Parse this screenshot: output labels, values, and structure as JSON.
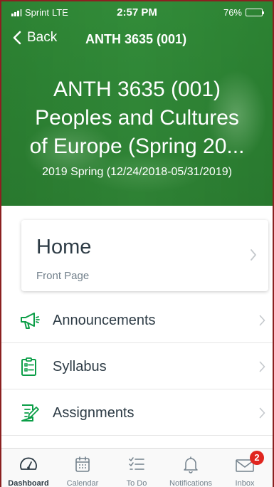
{
  "status_bar": {
    "carrier": "Sprint",
    "network": "LTE",
    "time": "2:57 PM",
    "battery": "76%",
    "battery_level": 0.76
  },
  "nav": {
    "back_label": "Back",
    "title": "ANTH 3635 (001)"
  },
  "course": {
    "title_line1": "ANTH 3635 (001)",
    "title_line2": "Peoples and Cultures",
    "title_line3": "of Europe (Spring 20...",
    "term_dates": "2019 Spring (12/24/2018-05/31/2019)"
  },
  "home": {
    "title": "Home",
    "subtitle": "Front Page"
  },
  "menu": [
    {
      "label": "Announcements",
      "icon": "megaphone-icon"
    },
    {
      "label": "Syllabus",
      "icon": "syllabus-icon"
    },
    {
      "label": "Assignments",
      "icon": "assignments-icon"
    }
  ],
  "tabbar": {
    "tabs": [
      {
        "label": "Dashboard",
        "icon": "dashboard-icon",
        "active": true
      },
      {
        "label": "Calendar",
        "icon": "calendar-icon"
      },
      {
        "label": "To Do",
        "icon": "todo-icon"
      },
      {
        "label": "Notifications",
        "icon": "bell-icon"
      },
      {
        "label": "Inbox",
        "icon": "inbox-icon",
        "badge": "2"
      }
    ]
  },
  "colors": {
    "brand_green": "#2d8534",
    "icon_green": "#0b9e47",
    "text_dark": "#2d3b45",
    "text_muted": "#73818c",
    "badge_red": "#e0261f"
  }
}
